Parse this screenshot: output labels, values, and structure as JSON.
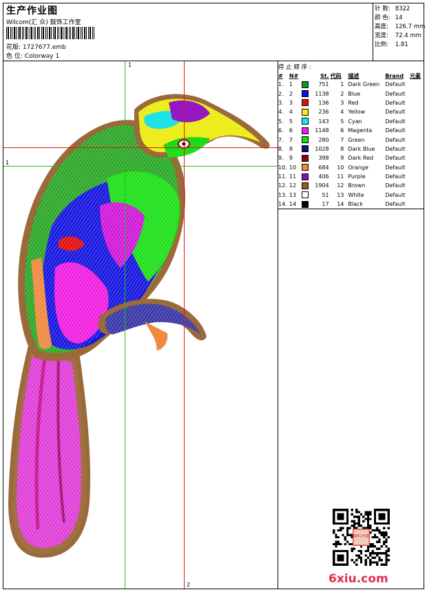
{
  "header": {
    "title": "生产作业图",
    "company": "Wilcom(汇 众) 鼓饰工作室",
    "design_label": "花版:",
    "design_value": "1727677.emb",
    "colorway_label": "色 位:",
    "colorway_value": "Colorway 1"
  },
  "stats": [
    {
      "label": "针 数:",
      "value": "8322"
    },
    {
      "label": "颜 色:",
      "value": "14"
    },
    {
      "label": "高度:",
      "value": "126.7 mm"
    },
    {
      "label": "宽度:",
      "value": "72.4 mm"
    },
    {
      "label": "比例:",
      "value": "1.81"
    }
  ],
  "guides": {
    "h_left": "1",
    "v_top": "1",
    "v_bottom": "2"
  },
  "stop_sequence": {
    "title": "停 止 顺 序 :",
    "headers": [
      "#",
      "N#",
      "",
      "St.",
      "代码",
      "描述",
      "Brand",
      "元素"
    ],
    "rows": [
      {
        "idx": "1.",
        "n": "1",
        "color": "#0f9a25",
        "st": "751",
        "code": "1",
        "desc": "Dark Green",
        "brand": "Default"
      },
      {
        "idx": "2.",
        "n": "2",
        "color": "#1010e0",
        "st": "1138",
        "code": "2",
        "desc": "Blue",
        "brand": "Default"
      },
      {
        "idx": "3.",
        "n": "3",
        "color": "#e01010",
        "st": "136",
        "code": "3",
        "desc": "Red",
        "brand": "Default"
      },
      {
        "idx": "4.",
        "n": "4",
        "color": "#f7f000",
        "st": "236",
        "code": "4",
        "desc": "Yellow",
        "brand": "Default"
      },
      {
        "idx": "5.",
        "n": "5",
        "color": "#20e8f0",
        "st": "143",
        "code": "5",
        "desc": "Cyan",
        "brand": "Default"
      },
      {
        "idx": "6.",
        "n": "6",
        "color": "#f020e8",
        "st": "1148",
        "code": "6",
        "desc": "Magenta",
        "brand": "Default"
      },
      {
        "idx": "7.",
        "n": "7",
        "color": "#10e010",
        "st": "280",
        "code": "7",
        "desc": "Green",
        "brand": "Default"
      },
      {
        "idx": "8.",
        "n": "8",
        "color": "#10108a",
        "st": "1028",
        "code": "8",
        "desc": "Dark Blue",
        "brand": "Default"
      },
      {
        "idx": "9.",
        "n": "9",
        "color": "#900808",
        "st": "398",
        "code": "9",
        "desc": "Dark Red",
        "brand": "Default"
      },
      {
        "idx": "10.",
        "n": "10",
        "color": "#f08a40",
        "st": "684",
        "code": "10",
        "desc": "Orange",
        "brand": "Default"
      },
      {
        "idx": "11.",
        "n": "11",
        "color": "#8a10b8",
        "st": "406",
        "code": "11",
        "desc": "Purple",
        "brand": "Default"
      },
      {
        "idx": "12.",
        "n": "12",
        "color": "#9a5a2a",
        "st": "1904",
        "code": "12",
        "desc": "Brown",
        "brand": "Default"
      },
      {
        "idx": "13.",
        "n": "13",
        "color": "#ffffff",
        "st": "51",
        "code": "13",
        "desc": "White",
        "brand": "Default"
      },
      {
        "idx": "14.",
        "n": "14",
        "color": "#000000",
        "st": "17",
        "code": "14",
        "desc": "Black",
        "brand": "Default"
      }
    ]
  },
  "watermark": "6xiu.com",
  "qr_stamp": "鼓饰工作室"
}
